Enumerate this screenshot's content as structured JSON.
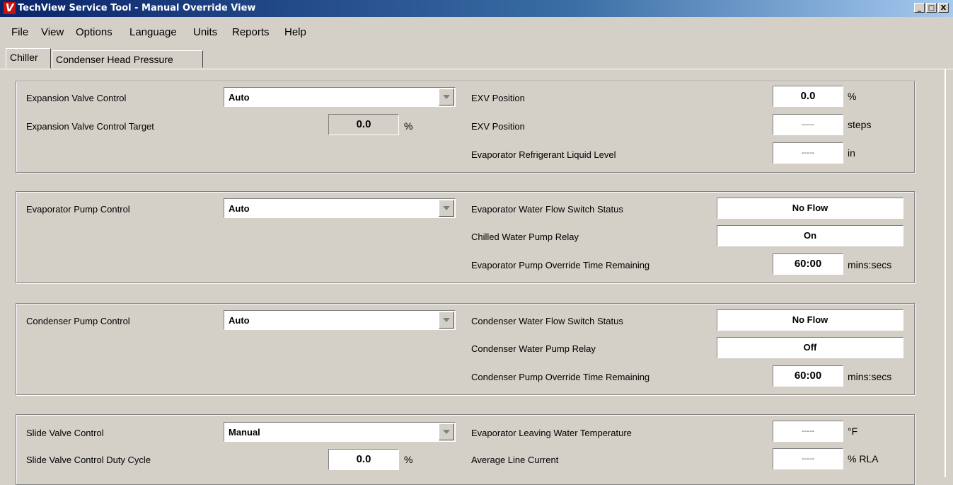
{
  "window": {
    "title": "TechView Service Tool - Manual Override View",
    "app_icon_letter": "V"
  },
  "window_buttons": {
    "minimize": "_",
    "maximize": "□",
    "close": "X"
  },
  "menu": [
    "File",
    "View",
    "Options",
    "Language",
    "Units",
    "Reports",
    "Help"
  ],
  "tabs": [
    "Chiller",
    "Condenser Head Pressure"
  ],
  "groups": {
    "expansion": {
      "control_label": "Expansion Valve Control",
      "control_value": "Auto",
      "target_label": "Expansion Valve Control Target",
      "target_value": "0.0",
      "target_unit": "%",
      "status": [
        {
          "label": "EXV Position",
          "value": "0.0",
          "unit": "%"
        },
        {
          "label": "EXV Position",
          "value": "-----",
          "unit": "steps"
        },
        {
          "label": "Evaporator Refrigerant Liquid Level",
          "value": "-----",
          "unit": "in"
        }
      ]
    },
    "evap_pump": {
      "control_label": "Evaporator Pump Control",
      "control_value": "Auto",
      "status": [
        {
          "label": "Evaporator Water Flow Switch Status",
          "value": "No Flow"
        },
        {
          "label": "Chilled Water Pump Relay",
          "value": "On"
        },
        {
          "label": "Evaporator Pump Override Time Remaining",
          "value": "60:00",
          "unit": "mins:secs"
        }
      ]
    },
    "cond_pump": {
      "control_label": "Condenser Pump Control",
      "control_value": "Auto",
      "status": [
        {
          "label": "Condenser Water Flow Switch Status",
          "value": "No Flow"
        },
        {
          "label": "Condenser Water Pump Relay",
          "value": "Off"
        },
        {
          "label": "Condenser Pump Override Time Remaining",
          "value": "60:00",
          "unit": "mins:secs"
        }
      ]
    },
    "slide": {
      "control_label": "Slide Valve Control",
      "control_value": "Manual",
      "duty_label": "Slide Valve Control Duty Cycle",
      "duty_value": "0.0",
      "duty_unit": "%",
      "status": [
        {
          "label": "Evaporator Leaving Water Temperature",
          "value": "-----",
          "unit": "°F"
        },
        {
          "label": "Average Line Current",
          "value": "-----",
          "unit": "% RLA"
        }
      ]
    }
  }
}
